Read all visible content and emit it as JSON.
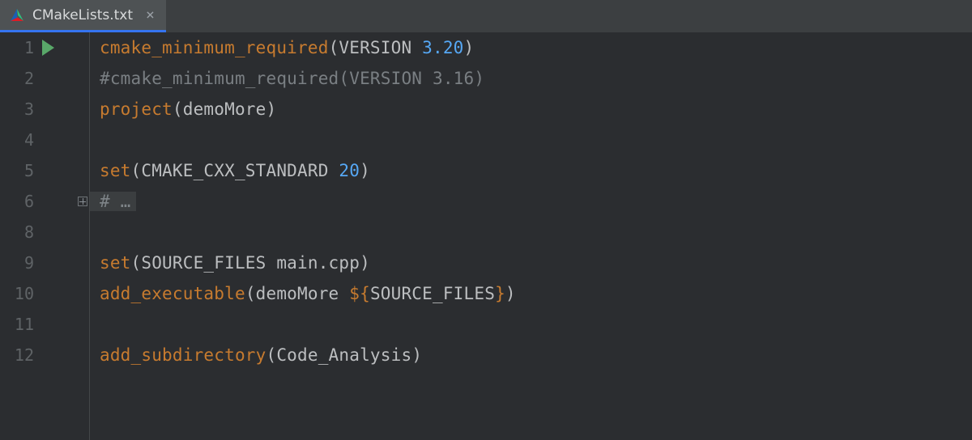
{
  "tab": {
    "filename": "CMakeLists.txt"
  },
  "lines": {
    "l1": {
      "num": "1",
      "fn": "cmake_minimum_required",
      "arg1": "VERSION",
      "arg2": "3.20"
    },
    "l2": {
      "num": "2",
      "text": "#cmake_minimum_required(VERSION 3.16)"
    },
    "l3": {
      "num": "3",
      "fn": "project",
      "arg1": "demoMore"
    },
    "l4": {
      "num": "4"
    },
    "l5": {
      "num": "5",
      "fn": "set",
      "arg1": "CMAKE_CXX_STANDARD",
      "arg2": "20"
    },
    "l6": {
      "num": "6",
      "text": "# …"
    },
    "l8": {
      "num": "8"
    },
    "l9": {
      "num": "9",
      "fn": "set",
      "arg1": "SOURCE_FILES",
      "arg2": "main.cpp"
    },
    "l10": {
      "num": "10",
      "fn": "add_executable",
      "arg1": "demoMore",
      "varopen": "${",
      "var": "SOURCE_FILES",
      "varclose": "}"
    },
    "l11": {
      "num": "11"
    },
    "l12": {
      "num": "12",
      "fn": "add_subdirectory",
      "arg1": "Code_Analysis"
    }
  }
}
